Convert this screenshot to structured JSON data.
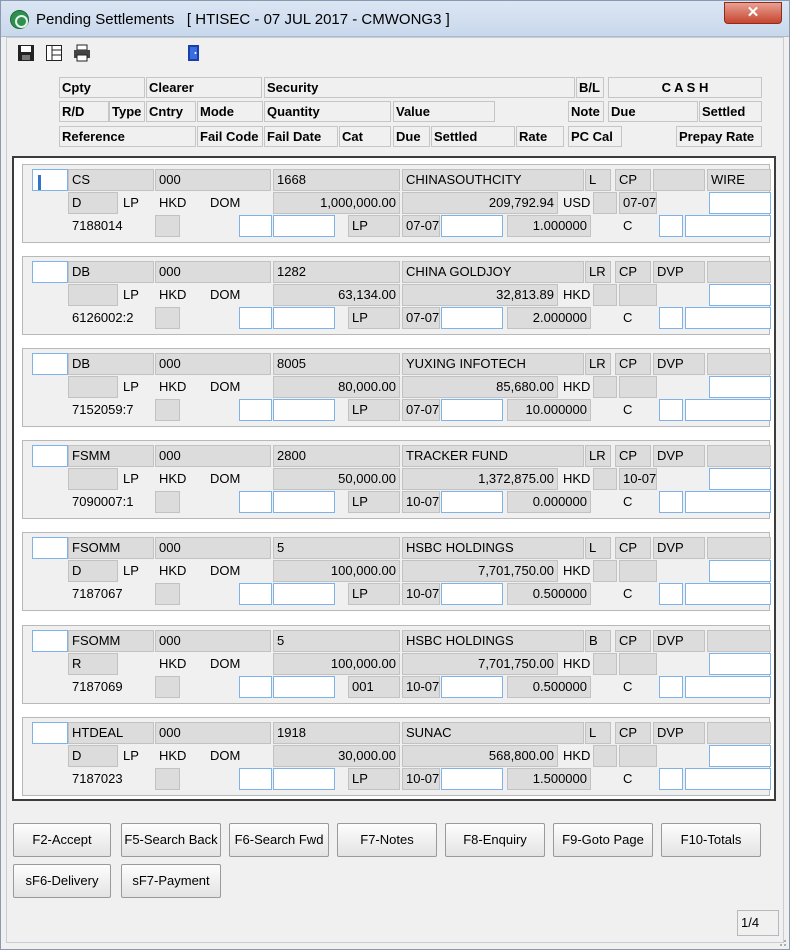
{
  "window": {
    "title": "Pending Settlements   [ HTISEC - 07 JUL 2017 - CMWONG3 ]",
    "close_glyph": "✕"
  },
  "toolbar": {
    "icons": [
      "save-icon",
      "layout-icon",
      "print-icon",
      "exit-door-icon"
    ]
  },
  "headers": {
    "cpty": "Cpty",
    "clearer": "Clearer",
    "security": "Security",
    "bl": "B/L",
    "cash": "C A S H",
    "rd": "R/D",
    "type": "Type",
    "cntry": "Cntry",
    "mode": "Mode",
    "quantity": "Quantity",
    "value": "Value",
    "note": "Note",
    "due": "Due",
    "settled": "Settled",
    "reference": "Reference",
    "fail_code": "Fail Code",
    "fail_date": "Fail Date",
    "cat": "Cat",
    "due2": "Due",
    "settled2": "Settled",
    "rate": "Rate",
    "pc_cal": "PC Cal",
    "prepay_rate": "Prepay Rate"
  },
  "records": [
    {
      "cpty": "CS",
      "clearer": "000",
      "security": "1668",
      "name": "CHINASOUTHCITY",
      "bl": "L",
      "cp": "CP",
      "col13": "",
      "cash": "WIRE",
      "rd": "D",
      "type": "LP",
      "cntry": "HKD",
      "mode": "DOM",
      "quantity": "1,000,000.00",
      "value": "209,792.94",
      "currency": "USD",
      "due": "07-07",
      "reference": "7188014",
      "cat": "LP",
      "due2": "07-07",
      "rate": "1.000000",
      "pccal": "C"
    },
    {
      "cpty": "DB",
      "clearer": "000",
      "security": "1282",
      "name": "CHINA GOLDJOY",
      "bl": "LR",
      "cp": "CP",
      "col13": "DVP",
      "cash": "",
      "rd": "",
      "type": "LP",
      "cntry": "HKD",
      "mode": "DOM",
      "quantity": "63,134.00",
      "value": "32,813.89",
      "currency": "HKD",
      "due": "",
      "reference": "6126002:2",
      "cat": "LP",
      "due2": "07-07",
      "rate": "2.000000",
      "pccal": "C"
    },
    {
      "cpty": "DB",
      "clearer": "000",
      "security": "8005",
      "name": "YUXING INFOTECH",
      "bl": "LR",
      "cp": "CP",
      "col13": "DVP",
      "cash": "",
      "rd": "",
      "type": "LP",
      "cntry": "HKD",
      "mode": "DOM",
      "quantity": "80,000.00",
      "value": "85,680.00",
      "currency": "HKD",
      "due": "",
      "reference": "7152059:7",
      "cat": "LP",
      "due2": "07-07",
      "rate": "10.000000",
      "pccal": "C"
    },
    {
      "cpty": "FSMM",
      "clearer": "000",
      "security": "2800",
      "name": "TRACKER FUND",
      "bl": "LR",
      "cp": "CP",
      "col13": "DVP",
      "cash": "",
      "rd": "",
      "type": "LP",
      "cntry": "HKD",
      "mode": "DOM",
      "quantity": "50,000.00",
      "value": "1,372,875.00",
      "currency": "HKD",
      "due": "10-07",
      "reference": "7090007:1",
      "cat": "LP",
      "due2": "10-07",
      "rate": "0.000000",
      "pccal": "C"
    },
    {
      "cpty": "FSOMM",
      "clearer": "000",
      "security": "5",
      "name": "HSBC HOLDINGS",
      "bl": "L",
      "cp": "CP",
      "col13": "DVP",
      "cash": "",
      "rd": "D",
      "type": "LP",
      "cntry": "HKD",
      "mode": "DOM",
      "quantity": "100,000.00",
      "value": "7,701,750.00",
      "currency": "HKD",
      "due": "",
      "reference": "7187067",
      "cat": "LP",
      "due2": "10-07",
      "rate": "0.500000",
      "pccal": "C"
    },
    {
      "cpty": "FSOMM",
      "clearer": "000",
      "security": "5",
      "name": "HSBC HOLDINGS",
      "bl": "B",
      "cp": "CP",
      "col13": "DVP",
      "cash": "",
      "rd": "R",
      "type": "",
      "cntry": "HKD",
      "mode": "DOM",
      "quantity": "100,000.00",
      "value": "7,701,750.00",
      "currency": "HKD",
      "due": "",
      "reference": "7187069",
      "cat": "001",
      "due2": "10-07",
      "rate": "0.500000",
      "pccal": "C"
    },
    {
      "cpty": "HTDEAL",
      "clearer": "000",
      "security": "1918",
      "name": "SUNAC",
      "bl": "L",
      "cp": "CP",
      "col13": "DVP",
      "cash": "",
      "rd": "D",
      "type": "LP",
      "cntry": "HKD",
      "mode": "DOM",
      "quantity": "30,000.00",
      "value": "568,800.00",
      "currency": "HKD",
      "due": "",
      "reference": "7187023",
      "cat": "LP",
      "due2": "10-07",
      "rate": "1.500000",
      "pccal": "C"
    }
  ],
  "buttons": {
    "f2": "F2-Accept",
    "f5": "F5-Search Back",
    "f6": "F6-Search Fwd",
    "f7": "F7-Notes",
    "f8": "F8-Enquiry",
    "f9": "F9-Goto Page",
    "f10": "F10-Totals",
    "sf6": "sF6-Delivery",
    "sf7": "sF7-Payment"
  },
  "status": {
    "page": "1/4"
  }
}
